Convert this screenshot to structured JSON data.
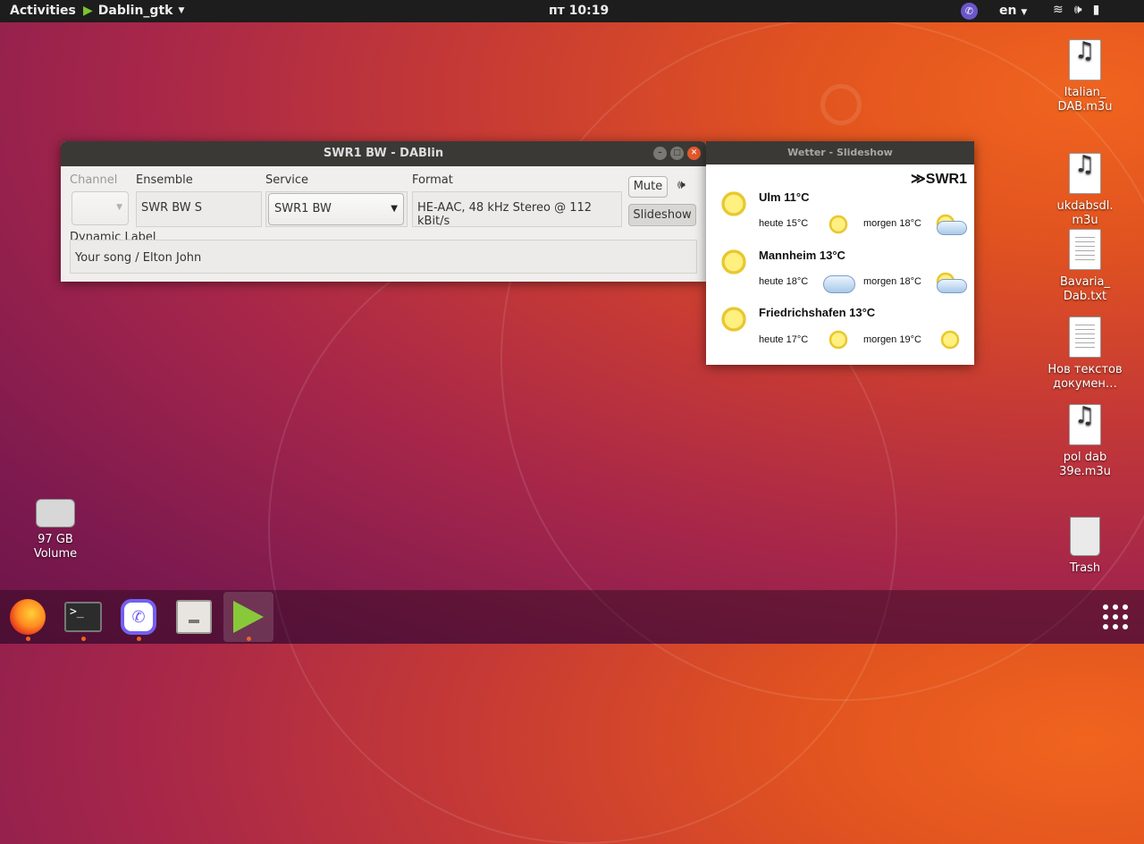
{
  "topbar": {
    "activities": "Activities",
    "app_name": "Dablin_gtk",
    "clock": "пт 10:19",
    "lang": "en"
  },
  "dablin": {
    "title": "SWR1 BW - DABlin",
    "channel": {
      "label": "Channel",
      "value": ""
    },
    "ensemble": {
      "label": "Ensemble",
      "value": "SWR BW S"
    },
    "service": {
      "label": "Service",
      "value": "SWR1 BW"
    },
    "format": {
      "label": "Format",
      "value": "HE-AAC, 48 kHz Stereo @ 112 kBit/s"
    },
    "mute_label": "Mute",
    "slideshow_label": "Slideshow",
    "dynamic_label": {
      "label": "Dynamic Label",
      "value": "Your song / Elton John"
    }
  },
  "slideshow": {
    "title": "Wetter - Slideshow",
    "logo": "≫SWR1",
    "cities": [
      {
        "name": "Ulm 11°C",
        "today": "heute 15°C",
        "tomorrow": "morgen 18°C",
        "today_icon": "sun",
        "tomorrow_icon": "sun-cloud"
      },
      {
        "name": "Mannheim 13°C",
        "today": "heute 18°C",
        "tomorrow": "morgen 18°C",
        "today_icon": "cloud",
        "tomorrow_icon": "sun-cloud"
      },
      {
        "name": "Friedrichshafen 13°C",
        "today": "heute 17°C",
        "tomorrow": "morgen 19°C",
        "today_icon": "sun",
        "tomorrow_icon": "sun"
      }
    ]
  },
  "desktop_icons": [
    {
      "label": "Italian_ DAB.m3u",
      "icon": "audio-file-icon"
    },
    {
      "label": "ukdabsdl. m3u",
      "icon": "audio-file-icon"
    },
    {
      "label": "Bavaria_ Dab.txt",
      "icon": "text-file-icon"
    },
    {
      "label": "Нов текстов докумен…",
      "icon": "text-file-icon"
    },
    {
      "label": "pol dab 39e.m3u",
      "icon": "audio-file-icon"
    },
    {
      "label": "Trash",
      "icon": "trash-icon"
    },
    {
      "label": "97 GB Volume",
      "icon": "drive-icon"
    }
  ],
  "colors": {
    "accent": "#f0641f",
    "dock_active_play": "#88c93a",
    "close_button": "#e5582c"
  }
}
